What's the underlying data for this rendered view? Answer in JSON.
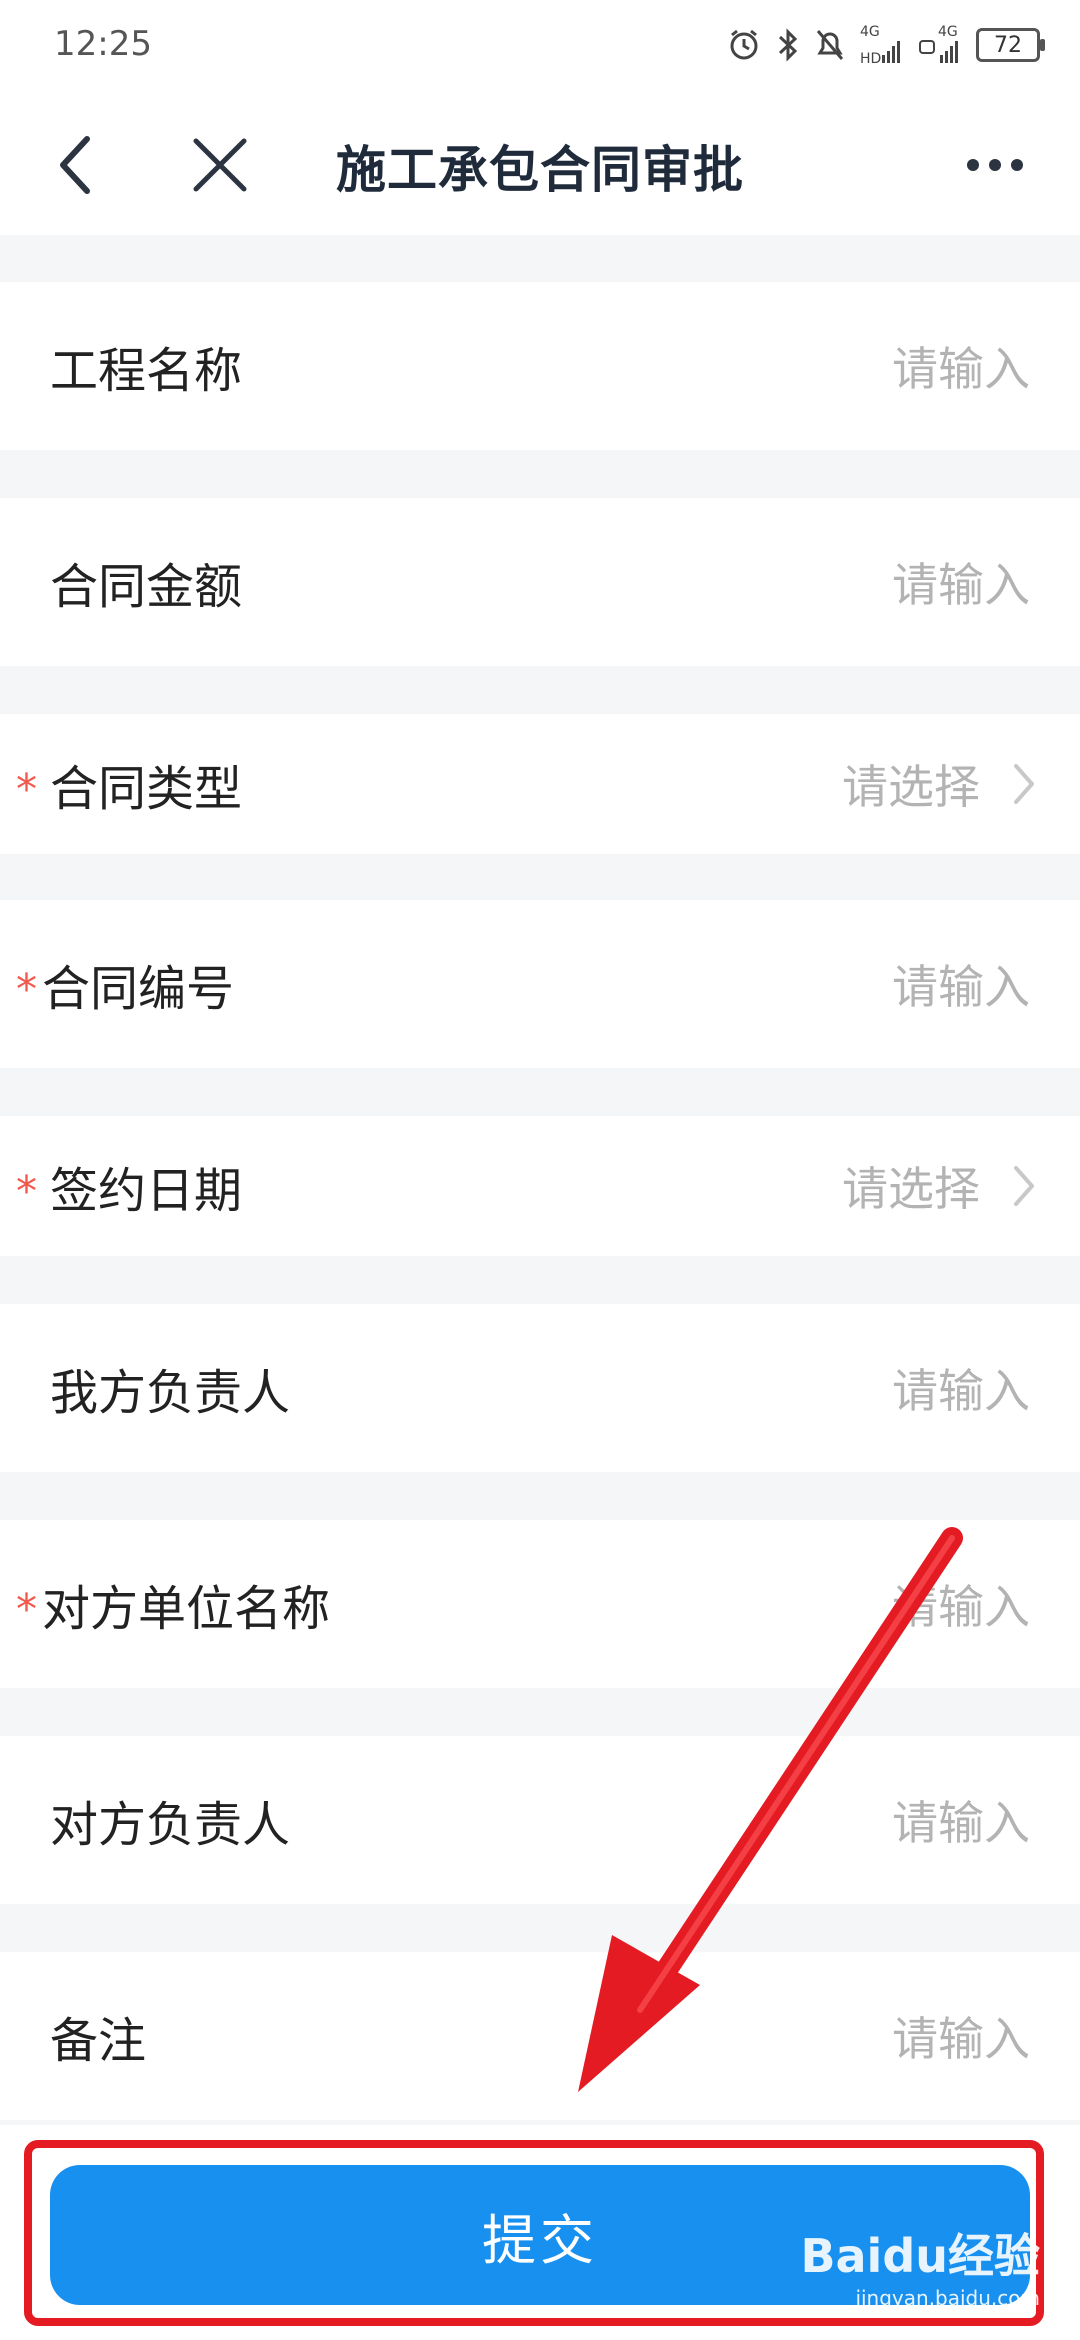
{
  "status_bar": {
    "time": "12:25",
    "network1": "4G",
    "network2": "4G",
    "battery": "72"
  },
  "nav": {
    "title": "施工承包合同审批"
  },
  "form": {
    "rows": [
      {
        "label": "工程名称",
        "placeholder": "请输入",
        "required": false
      },
      {
        "label": "合同金额",
        "placeholder": "请输入",
        "required": false
      },
      {
        "label": "合同类型",
        "placeholder": "请选择",
        "required": true
      },
      {
        "label": "合同编号",
        "placeholder": "请输入",
        "required": true
      },
      {
        "label": "签约日期",
        "placeholder": "请选择",
        "required": true
      },
      {
        "label": "我方负责人",
        "placeholder": "请输入",
        "required": false
      },
      {
        "label": "对方单位名称",
        "placeholder": "请输入",
        "required": true
      },
      {
        "label": "对方负责人",
        "placeholder": "请输入",
        "required": false
      },
      {
        "label": "备注",
        "placeholder": "请输入",
        "required": false
      }
    ],
    "required_mark": "*"
  },
  "submit": {
    "label": "提交"
  },
  "watermark": {
    "logo": "Baidu经验",
    "sub": "jingyan.baidu.com"
  },
  "colors": {
    "accent": "#1890f0",
    "required": "#f0594c",
    "highlight": "#e41b23"
  }
}
